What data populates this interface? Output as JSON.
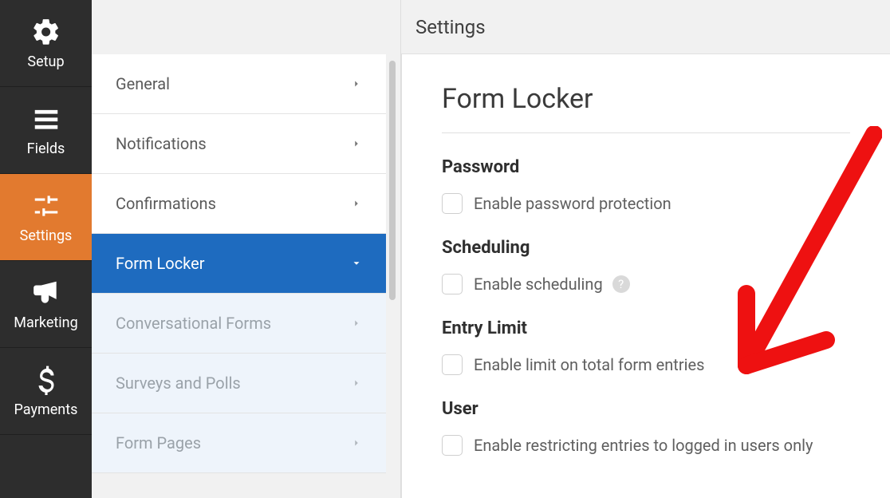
{
  "rail": {
    "items": [
      {
        "label": "Setup"
      },
      {
        "label": "Fields"
      },
      {
        "label": "Settings"
      },
      {
        "label": "Marketing"
      },
      {
        "label": "Payments"
      }
    ]
  },
  "topbar": {
    "title": "Settings"
  },
  "submenu": {
    "items": [
      {
        "label": "General"
      },
      {
        "label": "Notifications"
      },
      {
        "label": "Confirmations"
      },
      {
        "label": "Form Locker"
      },
      {
        "label": "Conversational Forms"
      },
      {
        "label": "Surveys and Polls"
      },
      {
        "label": "Form Pages"
      }
    ]
  },
  "panel": {
    "title": "Form Locker",
    "sections": [
      {
        "heading": "Password",
        "option": "Enable password protection"
      },
      {
        "heading": "Scheduling",
        "option": "Enable scheduling"
      },
      {
        "heading": "Entry Limit",
        "option": "Enable limit on total form entries"
      },
      {
        "heading": "User",
        "option": "Enable restricting entries to logged in users only"
      }
    ]
  }
}
